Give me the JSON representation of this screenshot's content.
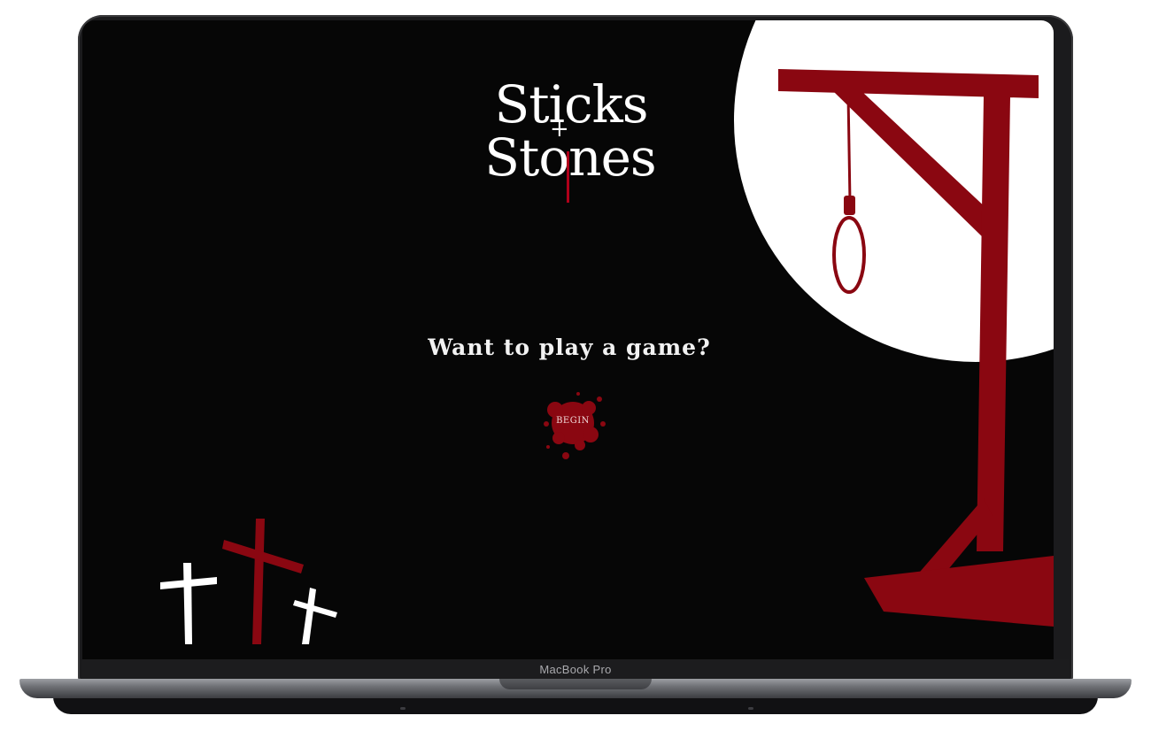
{
  "device": {
    "model_label": "MacBook Pro"
  },
  "game": {
    "logo_line1": "Sticks",
    "logo_plus": "+",
    "logo_line2": "Stones",
    "tagline": "Want to play a game?",
    "begin_label": "BEGIN"
  },
  "colors": {
    "background": "#060606",
    "blood_red": "#8a0711",
    "moon_white": "#ffffff",
    "text_white": "#f2f2f2"
  },
  "icons": [
    "gallows-icon",
    "noose-icon",
    "moon-icon",
    "cross-icon",
    "blood-splatter-icon"
  ]
}
